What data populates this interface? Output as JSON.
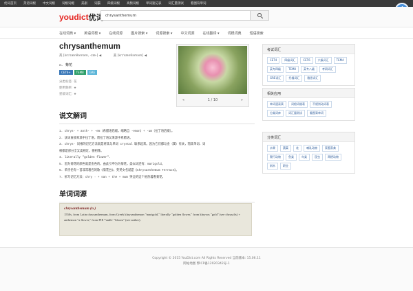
{
  "topbar": {
    "links": [
      "优词首页",
      "英语词根",
      "中文词根",
      "词根词缀",
      "美剧",
      "词霸",
      "四级词根",
      "高频词根",
      "单词速记表",
      "词汇量测试",
      "看图背单词"
    ]
  },
  "logo": {
    "brand": "youdict",
    "cn": "优词"
  },
  "search": {
    "value": "chrysanthemum"
  },
  "nav": {
    "items": [
      "在线词典 ▾",
      "英语词根 ▾",
      "在线词源",
      "图片搜索 ▾",
      "词源搜索 ▾",
      "中文词源",
      "在线翻译 ▾",
      "词根词典",
      "短语搜索"
    ]
  },
  "entry": {
    "word": "chrysanthemum",
    "phon_uk": "英 [krɪˈsænθəməm, -zæ-] ◀",
    "phon_us": "美 [krɪˈsænθəməm] ◀",
    "pos": "n.",
    "meaning": "菊花",
    "tags": [
      {
        "label": "CET6+",
        "color": "#3a78b8"
      },
      {
        "label": "TEM8",
        "color": "#2e9e6a"
      },
      {
        "label": "GRE",
        "color": "#5bb5d8"
      }
    ],
    "meta": [
      "分类标签: 花",
      "使用频率: ★",
      "星级词汇: ★"
    ]
  },
  "image": {
    "page": "1 / 10",
    "prev": "«",
    "next": "»"
  },
  "etymology": {
    "title": "说文解词",
    "lines": [
      "1. chrys- + anth- + -em（希腊语后缀，缩略自 -emon）+ -um（拉丁语后缀）。",
      "2. 该词直接来源于拉丁语，而拉丁语又来源于希腊语。",
      "3. chrys- 词根的记忆方法就是将其与单词 crystal 联系起来。因为它们都与金（属）有关，而其单词、词",
      "   根都是部分全又类相近，便相像。",
      "4. literally \"golden flower\".",
      "5. 因为菊花的颜色就是金色的，由此引申为为菊花，类似词还有：marigold。",
      "6. 单杰伦有一首非常著名的歌《菊花台》，英英文名就是《Chrysanthemum Terrace》。",
      "7. 拆写记忆方法：chry · + san + the + mum 哭泣的这个他热着看菊花。"
    ]
  },
  "word_origin": {
    "title": "单词词源",
    "head": "chrysanthemum (n.)",
    "body": "1550s, from Latin chrysanthemum, from Greek khrysanthemon \"marigold,\" literally \"golden flower,\" from khrysos \"gold\" (see chrysalis) + anthemon \"a flower,\" from PIE *andh- \"bloom\" (see anther)."
  },
  "sidebar": {
    "panels": [
      {
        "title": "考试词汇",
        "items": [
          "CET4",
          "四级词汇",
          "CET6",
          "六级词汇",
          "TEM4",
          "英专四级",
          "TEM8",
          "英专八级",
          "考研词汇",
          "GRE词汇",
          "托福词汇",
          "雅思词汇"
        ]
      },
      {
        "title": "相关应用",
        "items": [
          "单词速读表",
          "词根词缀表",
          "不规则动词表",
          "分类词库",
          "词汇量测试",
          "看图背单词"
        ]
      },
      {
        "title": "分类词汇",
        "items": [
          "水果",
          "蔬菜",
          "花",
          "哺乳动物",
          "家畜家禽",
          "爬行动物",
          "鱼类",
          "鸟类",
          "昆虫",
          "两栖动物",
          "树木",
          "职业"
        ]
      }
    ]
  },
  "footer": {
    "line1": "Copyright © 2015 YouDict.com All Rights Reserved 当前版本: 15.06.11",
    "line2": "网站地图 鄂ICP备12020342号-1"
  }
}
